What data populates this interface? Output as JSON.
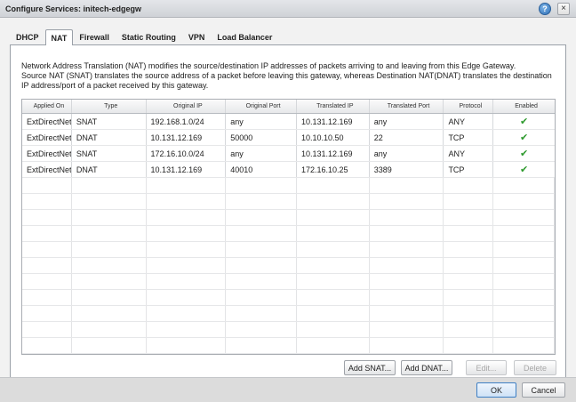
{
  "window": {
    "title": "Configure Services: initech-edgegw",
    "help_icon": "?",
    "close_icon": "×"
  },
  "tabs": [
    {
      "label": "DHCP"
    },
    {
      "label": "NAT",
      "active": true
    },
    {
      "label": "Firewall"
    },
    {
      "label": "Static Routing"
    },
    {
      "label": "VPN"
    },
    {
      "label": "Load Balancer"
    }
  ],
  "nat": {
    "description_line1": "Network Address Translation (NAT) modifies the source/destination IP addresses of packets arriving to and leaving from this Edge Gateway.",
    "description_line2": "Source NAT (SNAT) translates the source address of a packet before leaving this gateway, whereas Destination NAT(DNAT) translates the destination IP address/port of a packet received by this gateway.",
    "columns": [
      "Applied On",
      "Type",
      "Original IP",
      "Original Port",
      "Translated IP",
      "Translated Port",
      "Protocol",
      "Enabled"
    ],
    "rows": [
      {
        "applied_on": "ExtDirectNet",
        "type": "SNAT",
        "original_ip": "192.168.1.0/24",
        "original_port": "any",
        "translated_ip": "10.131.12.169",
        "translated_port": "any",
        "protocol": "ANY",
        "enabled": "✔"
      },
      {
        "applied_on": "ExtDirectNet",
        "type": "DNAT",
        "original_ip": "10.131.12.169",
        "original_port": "50000",
        "translated_ip": "10.10.10.50",
        "translated_port": "22",
        "protocol": "TCP",
        "enabled": "✔"
      },
      {
        "applied_on": "ExtDirectNet",
        "type": "SNAT",
        "original_ip": "172.16.10.0/24",
        "original_port": "any",
        "translated_ip": "10.131.12.169",
        "translated_port": "any",
        "protocol": "ANY",
        "enabled": "✔"
      },
      {
        "applied_on": "ExtDirectNet",
        "type": "DNAT",
        "original_ip": "10.131.12.169",
        "original_port": "40010",
        "translated_ip": "172.16.10.25",
        "translated_port": "3389",
        "protocol": "TCP",
        "enabled": "✔"
      }
    ],
    "buttons": {
      "add_snat": "Add SNAT...",
      "add_dnat": "Add DNAT...",
      "edit": "Edit...",
      "delete": "Delete"
    }
  },
  "footer": {
    "ok": "OK",
    "cancel": "Cancel"
  }
}
